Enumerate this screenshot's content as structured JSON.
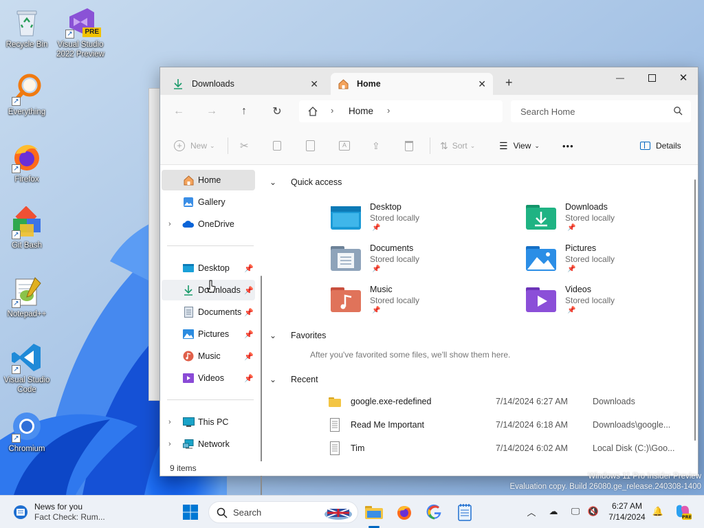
{
  "desktop": {
    "icons": [
      {
        "label_1": "Recycle Bin",
        "label_2": "",
        "icon": "recycle-bin-icon"
      },
      {
        "label_1": "Visual Studio",
        "label_2": "2022 Preview",
        "icon": "visual-studio-preview-icon",
        "badge": "PRE"
      },
      {
        "label_1": "Everything",
        "label_2": "",
        "icon": "everything-search-icon"
      },
      {
        "label_1": "Firefox",
        "label_2": "",
        "icon": "firefox-icon"
      },
      {
        "label_1": "Git Bash",
        "label_2": "",
        "icon": "git-bash-icon"
      },
      {
        "label_1": "Notepad++",
        "label_2": "",
        "icon": "notepad-plus-plus-icon"
      },
      {
        "label_1": "Visual Studio",
        "label_2": "Code",
        "icon": "vscode-icon"
      },
      {
        "label_1": "Chromium",
        "label_2": "",
        "icon": "chromium-icon"
      }
    ],
    "watermark_line1": "Windows 11 Pro Insider Preview",
    "watermark_line2": "Evaluation copy. Build 26080.ge_release.240308-1400"
  },
  "explorer": {
    "tabs": [
      {
        "label": "Downloads",
        "icon": "download-icon"
      },
      {
        "label": "Home",
        "icon": "home-icon"
      }
    ],
    "new_tab": "+",
    "address": {
      "crumb": "Home"
    },
    "search_placeholder": "Search Home",
    "toolbar": {
      "new_label": "New",
      "sort_label": "Sort",
      "view_label": "View",
      "more_label": "•••",
      "details_label": "Details"
    },
    "nav": {
      "home": "Home",
      "gallery": "Gallery",
      "onedrive": "OneDrive",
      "desktop": "Desktop",
      "downloads": "Downloads",
      "documents": "Documents",
      "pictures": "Pictures",
      "music": "Music",
      "videos": "Videos",
      "this_pc": "This PC",
      "network": "Network"
    },
    "sections": {
      "quick_access": "Quick access",
      "favorites": "Favorites",
      "favorites_empty": "After you've favorited some files, we'll show them here.",
      "recent": "Recent"
    },
    "quick_access": [
      {
        "name": "Desktop",
        "sub": "Stored locally"
      },
      {
        "name": "Downloads",
        "sub": "Stored locally"
      },
      {
        "name": "Documents",
        "sub": "Stored locally"
      },
      {
        "name": "Pictures",
        "sub": "Stored locally"
      },
      {
        "name": "Music",
        "sub": "Stored locally"
      },
      {
        "name": "Videos",
        "sub": "Stored locally"
      }
    ],
    "recent": [
      {
        "name": "google.exe-redefined",
        "date": "7/14/2024 6:27 AM",
        "location": "Downloads",
        "icon": "folder-icon"
      },
      {
        "name": "Read Me Important",
        "date": "7/14/2024 6:18 AM",
        "location": "Downloads\\google...",
        "icon": "text-file-icon"
      },
      {
        "name": "Tim",
        "date": "7/14/2024 6:02 AM",
        "location": "Local Disk (C:)\\Goo...",
        "icon": "text-file-icon"
      }
    ],
    "status": "9 items"
  },
  "taskbar": {
    "news_title": "News for you",
    "news_sub": "Fact Check: Rum...",
    "search_label": "Search",
    "time": "6:27 AM",
    "date": "7/14/2024",
    "colors": {
      "accent": "#0067c0",
      "taskbar_bg": "#edf1f7"
    }
  }
}
